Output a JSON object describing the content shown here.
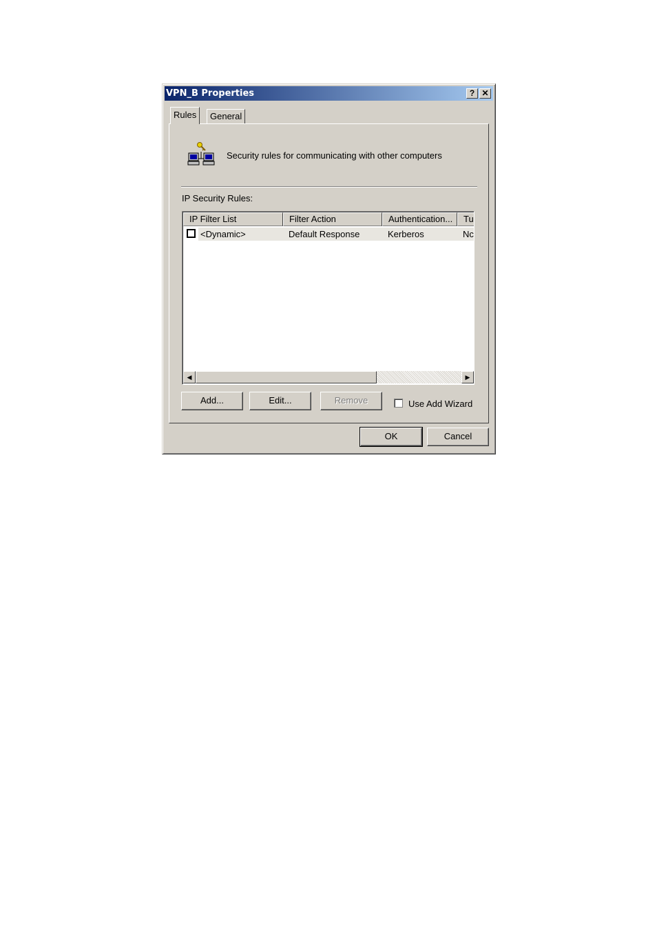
{
  "window": {
    "title": "VPN_B Properties",
    "help_label": "?",
    "close_label": "✕"
  },
  "tabs": [
    {
      "label": "Rules"
    },
    {
      "label": "General"
    }
  ],
  "header": {
    "description": "Security rules for communicating with other computers",
    "icon": "network-key-icon"
  },
  "rules": {
    "section_label": "IP Security Rules:",
    "columns": [
      "IP Filter List",
      "Filter Action",
      "Authentication...",
      "Tu"
    ],
    "rows": [
      {
        "checked": false,
        "ip_filter_list": "<Dynamic>",
        "filter_action": "Default Response",
        "authentication": "Kerberos",
        "tunnel": "Nc"
      }
    ]
  },
  "scrollbar": {
    "left_arrow": "◀",
    "right_arrow": "▶"
  },
  "buttons": {
    "add": "Add...",
    "edit": "Edit...",
    "remove": "Remove",
    "ok": "OK",
    "cancel": "Cancel"
  },
  "wizard": {
    "label": "Use Add Wizard",
    "checked": false
  }
}
